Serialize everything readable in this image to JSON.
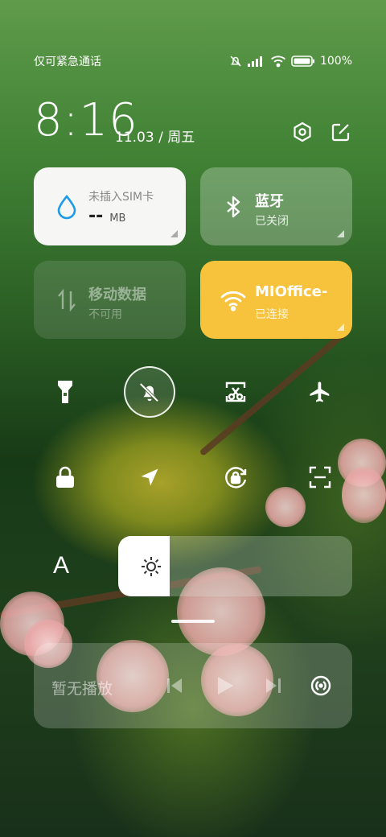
{
  "status_bar": {
    "carrier": "仅可紧急通话",
    "battery": "100%"
  },
  "header": {
    "time": "8:16",
    "date": "11.03 / 周五",
    "settings_icon": "settings-hexagon-icon",
    "edit_icon": "edit-icon"
  },
  "tiles": {
    "data_usage": {
      "title": "未插入SIM卡",
      "value": "--",
      "unit": "MB",
      "icon": "water-drop-icon"
    },
    "bluetooth": {
      "title": "蓝牙",
      "status": "已关闭",
      "icon": "bluetooth-icon"
    },
    "mobile_data": {
      "title": "移动数据",
      "status": "不可用",
      "icon": "data-arrows-icon"
    },
    "wifi": {
      "title": "MIOffice-",
      "status": "已连接",
      "icon": "wifi-icon"
    }
  },
  "toggles_row1": [
    "flashlight-icon",
    "mute-bell-icon",
    "screenshot-icon",
    "airplane-icon"
  ],
  "toggles_row2": [
    "lock-icon",
    "location-icon",
    "rotation-lock-icon",
    "scan-icon"
  ],
  "brightness": {
    "auto_label": "A",
    "level": 0.22
  },
  "media": {
    "label": "暂无播放"
  },
  "colors": {
    "wifi_tile": "#f7c23c",
    "data_tile": "#f6f6f4"
  }
}
